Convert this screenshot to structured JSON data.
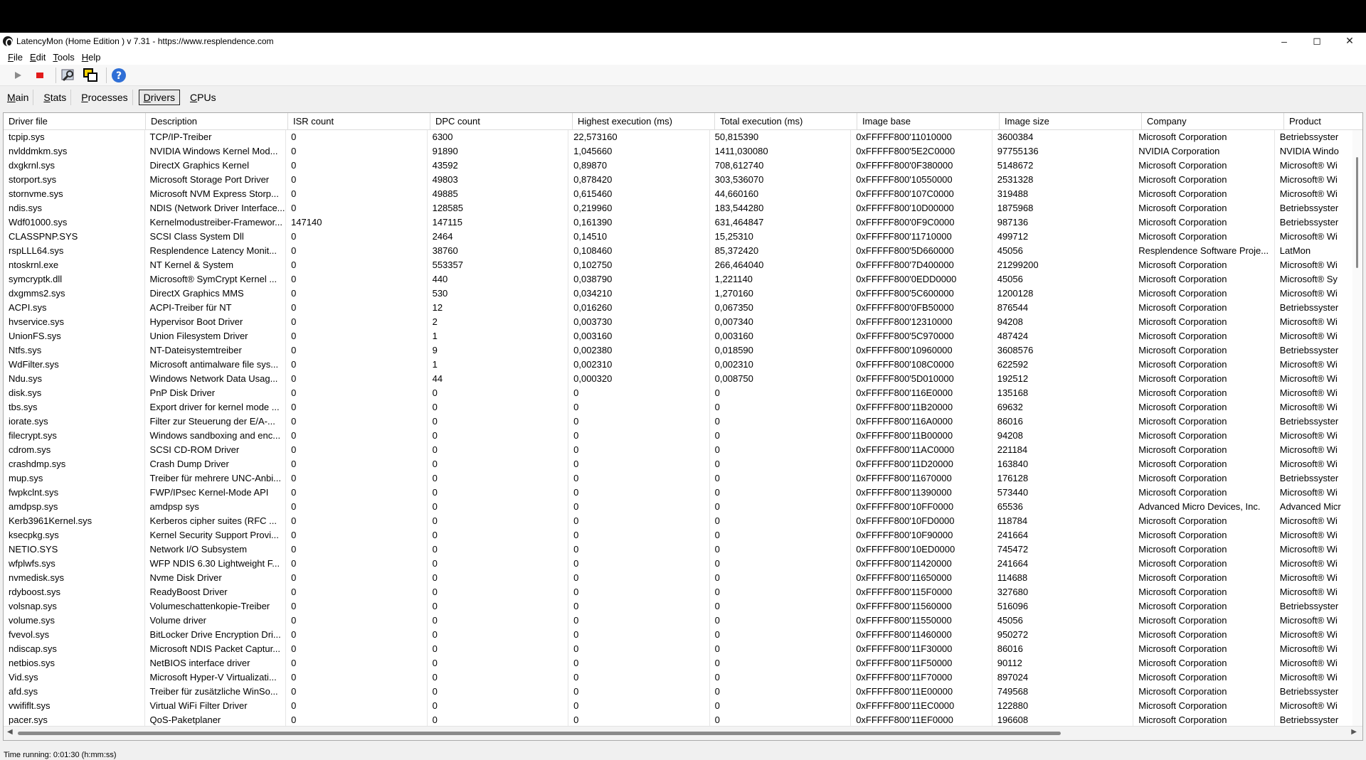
{
  "window": {
    "title": "LatencyMon  (Home Edition )  v 7.31 - https://www.resplendence.com",
    "controls": {
      "minimize": "–",
      "maximize": "◻",
      "close": "✕"
    }
  },
  "menu": [
    {
      "first": "F",
      "rest": "ile"
    },
    {
      "first": "E",
      "rest": "dit"
    },
    {
      "first": "T",
      "rest": "ools"
    },
    {
      "first": "H",
      "rest": "elp"
    }
  ],
  "toolbar": {
    "icons": [
      "play-icon",
      "stop-icon",
      "search-settings-icon",
      "windows-icon",
      "help-icon"
    ],
    "colors": {
      "play": "#8a8a8a",
      "stop": "#e21b1b",
      "help": "#2f6fd6"
    }
  },
  "tabs": [
    {
      "first": "M",
      "rest": "ain",
      "active": false
    },
    {
      "first": "S",
      "rest": "tats",
      "active": false
    },
    {
      "first": "P",
      "rest": "rocesses",
      "active": false
    },
    {
      "first": "D",
      "rest": "rivers",
      "active": true
    },
    {
      "first": "C",
      "rest": "PUs",
      "active": false
    }
  ],
  "table": {
    "columns": [
      "Driver file",
      "Description",
      "ISR count",
      "DPC count",
      "Highest execution (ms)",
      "Total execution (ms)",
      "Image base",
      "Image size",
      "Company",
      "Product"
    ],
    "rows": [
      [
        "tcpip.sys",
        "TCP/IP-Treiber",
        "0",
        "6300",
        "22,573160",
        "50,815390",
        "0xFFFFF800'11010000",
        "3600384",
        "Microsoft Corporation",
        "Betriebssyster"
      ],
      [
        "nvlddmkm.sys",
        "NVIDIA Windows Kernel Mod...",
        "0",
        "91890",
        "1,045660",
        "1411,030080",
        "0xFFFFF800'5E2C0000",
        "97755136",
        "NVIDIA Corporation",
        "NVIDIA Windo"
      ],
      [
        "dxgkrnl.sys",
        "DirectX Graphics Kernel",
        "0",
        "43592",
        "0,89870",
        "708,612740",
        "0xFFFFF800'0F380000",
        "5148672",
        "Microsoft Corporation",
        "Microsoft® Wi"
      ],
      [
        "storport.sys",
        "Microsoft Storage Port Driver",
        "0",
        "49803",
        "0,878420",
        "303,536070",
        "0xFFFFF800'10550000",
        "2531328",
        "Microsoft Corporation",
        "Microsoft® Wi"
      ],
      [
        "stornvme.sys",
        "Microsoft NVM Express Storp...",
        "0",
        "49885",
        "0,615460",
        "44,660160",
        "0xFFFFF800'107C0000",
        "319488",
        "Microsoft Corporation",
        "Microsoft® Wi"
      ],
      [
        "ndis.sys",
        "NDIS (Network Driver Interface...",
        "0",
        "128585",
        "0,219960",
        "183,544280",
        "0xFFFFF800'10D00000",
        "1875968",
        "Microsoft Corporation",
        "Betriebssyster"
      ],
      [
        "Wdf01000.sys",
        "Kernelmodustreiber-Framewor...",
        "147140",
        "147115",
        "0,161390",
        "631,464847",
        "0xFFFFF800'0F9C0000",
        "987136",
        "Microsoft Corporation",
        "Betriebssyster"
      ],
      [
        "CLASSPNP.SYS",
        "SCSI Class System Dll",
        "0",
        "2464",
        "0,14510",
        "15,25310",
        "0xFFFFF800'11710000",
        "499712",
        "Microsoft Corporation",
        "Microsoft® Wi"
      ],
      [
        "rspLLL64.sys",
        "Resplendence Latency Monit...",
        "0",
        "38760",
        "0,108460",
        "85,372420",
        "0xFFFFF800'5D660000",
        "45056",
        "Resplendence Software Proje...",
        "LatMon"
      ],
      [
        "ntoskrnl.exe",
        "NT Kernel & System",
        "0",
        "553357",
        "0,102750",
        "266,464040",
        "0xFFFFF800'7D400000",
        "21299200",
        "Microsoft Corporation",
        "Microsoft® Wi"
      ],
      [
        "symcryptk.dll",
        "Microsoft® SymCrypt Kernel ...",
        "0",
        "440",
        "0,038790",
        "1,221140",
        "0xFFFFF800'0EDD0000",
        "45056",
        "Microsoft Corporation",
        "Microsoft® Sy"
      ],
      [
        "dxgmms2.sys",
        "DirectX Graphics MMS",
        "0",
        "530",
        "0,034210",
        "1,270160",
        "0xFFFFF800'5C600000",
        "1200128",
        "Microsoft Corporation",
        "Microsoft® Wi"
      ],
      [
        "ACPI.sys",
        "ACPI-Treiber für NT",
        "0",
        "12",
        "0,016260",
        "0,067350",
        "0xFFFFF800'0FB50000",
        "876544",
        "Microsoft Corporation",
        "Betriebssyster"
      ],
      [
        "hvservice.sys",
        "Hypervisor Boot Driver",
        "0",
        "2",
        "0,003730",
        "0,007340",
        "0xFFFFF800'12310000",
        "94208",
        "Microsoft Corporation",
        "Microsoft® Wi"
      ],
      [
        "UnionFS.sys",
        "Union Filesystem Driver",
        "0",
        "1",
        "0,003160",
        "0,003160",
        "0xFFFFF800'5C970000",
        "487424",
        "Microsoft Corporation",
        "Microsoft® Wi"
      ],
      [
        "Ntfs.sys",
        "NT-Dateisystemtreiber",
        "0",
        "9",
        "0,002380",
        "0,018590",
        "0xFFFFF800'10960000",
        "3608576",
        "Microsoft Corporation",
        "Betriebssyster"
      ],
      [
        "WdFilter.sys",
        "Microsoft antimalware file sys...",
        "0",
        "1",
        "0,002310",
        "0,002310",
        "0xFFFFF800'108C0000",
        "622592",
        "Microsoft Corporation",
        "Microsoft® Wi"
      ],
      [
        "Ndu.sys",
        "Windows Network Data Usag...",
        "0",
        "44",
        "0,000320",
        "0,008750",
        "0xFFFFF800'5D010000",
        "192512",
        "Microsoft Corporation",
        "Microsoft® Wi"
      ],
      [
        "disk.sys",
        "PnP Disk Driver",
        "0",
        "0",
        "0",
        "0",
        "0xFFFFF800'116E0000",
        "135168",
        "Microsoft Corporation",
        "Microsoft® Wi"
      ],
      [
        "tbs.sys",
        "Export driver for kernel mode ...",
        "0",
        "0",
        "0",
        "0",
        "0xFFFFF800'11B20000",
        "69632",
        "Microsoft Corporation",
        "Microsoft® Wi"
      ],
      [
        "iorate.sys",
        "Filter zur Steuerung der E/A-...",
        "0",
        "0",
        "0",
        "0",
        "0xFFFFF800'116A0000",
        "86016",
        "Microsoft Corporation",
        "Betriebssyster"
      ],
      [
        "filecrypt.sys",
        "Windows sandboxing and enc...",
        "0",
        "0",
        "0",
        "0",
        "0xFFFFF800'11B00000",
        "94208",
        "Microsoft Corporation",
        "Microsoft® Wi"
      ],
      [
        "cdrom.sys",
        "SCSI CD-ROM Driver",
        "0",
        "0",
        "0",
        "0",
        "0xFFFFF800'11AC0000",
        "221184",
        "Microsoft Corporation",
        "Microsoft® Wi"
      ],
      [
        "crashdmp.sys",
        "Crash Dump Driver",
        "0",
        "0",
        "0",
        "0",
        "0xFFFFF800'11D20000",
        "163840",
        "Microsoft Corporation",
        "Microsoft® Wi"
      ],
      [
        "mup.sys",
        "Treiber für mehrere UNC-Anbi...",
        "0",
        "0",
        "0",
        "0",
        "0xFFFFF800'11670000",
        "176128",
        "Microsoft Corporation",
        "Betriebssyster"
      ],
      [
        "fwpkclnt.sys",
        "FWP/IPsec Kernel-Mode API",
        "0",
        "0",
        "0",
        "0",
        "0xFFFFF800'11390000",
        "573440",
        "Microsoft Corporation",
        "Microsoft® Wi"
      ],
      [
        "amdpsp.sys",
        "amdpsp sys",
        "0",
        "0",
        "0",
        "0",
        "0xFFFFF800'10FF0000",
        "65536",
        "Advanced Micro Devices, Inc.",
        "Advanced Micr"
      ],
      [
        "Kerb3961Kernel.sys",
        "Kerberos cipher suites (RFC ...",
        "0",
        "0",
        "0",
        "0",
        "0xFFFFF800'10FD0000",
        "118784",
        "Microsoft Corporation",
        "Microsoft® Wi"
      ],
      [
        "ksecpkg.sys",
        "Kernel Security Support Provi...",
        "0",
        "0",
        "0",
        "0",
        "0xFFFFF800'10F90000",
        "241664",
        "Microsoft Corporation",
        "Microsoft® Wi"
      ],
      [
        "NETIO.SYS",
        "Network I/O Subsystem",
        "0",
        "0",
        "0",
        "0",
        "0xFFFFF800'10ED0000",
        "745472",
        "Microsoft Corporation",
        "Microsoft® Wi"
      ],
      [
        "wfplwfs.sys",
        "WFP NDIS 6.30 Lightweight F...",
        "0",
        "0",
        "0",
        "0",
        "0xFFFFF800'11420000",
        "241664",
        "Microsoft Corporation",
        "Microsoft® Wi"
      ],
      [
        "nvmedisk.sys",
        "Nvme Disk Driver",
        "0",
        "0",
        "0",
        "0",
        "0xFFFFF800'11650000",
        "114688",
        "Microsoft Corporation",
        "Microsoft® Wi"
      ],
      [
        "rdyboost.sys",
        "ReadyBoost Driver",
        "0",
        "0",
        "0",
        "0",
        "0xFFFFF800'115F0000",
        "327680",
        "Microsoft Corporation",
        "Microsoft® Wi"
      ],
      [
        "volsnap.sys",
        "Volumeschattenkopie-Treiber",
        "0",
        "0",
        "0",
        "0",
        "0xFFFFF800'11560000",
        "516096",
        "Microsoft Corporation",
        "Betriebssyster"
      ],
      [
        "volume.sys",
        "Volume driver",
        "0",
        "0",
        "0",
        "0",
        "0xFFFFF800'11550000",
        "45056",
        "Microsoft Corporation",
        "Microsoft® Wi"
      ],
      [
        "fvevol.sys",
        "BitLocker Drive Encryption Dri...",
        "0",
        "0",
        "0",
        "0",
        "0xFFFFF800'11460000",
        "950272",
        "Microsoft Corporation",
        "Microsoft® Wi"
      ],
      [
        "ndiscap.sys",
        "Microsoft NDIS Packet Captur...",
        "0",
        "0",
        "0",
        "0",
        "0xFFFFF800'11F30000",
        "86016",
        "Microsoft Corporation",
        "Microsoft® Wi"
      ],
      [
        "netbios.sys",
        "NetBIOS interface driver",
        "0",
        "0",
        "0",
        "0",
        "0xFFFFF800'11F50000",
        "90112",
        "Microsoft Corporation",
        "Microsoft® Wi"
      ],
      [
        "Vid.sys",
        "Microsoft Hyper-V Virtualizati...",
        "0",
        "0",
        "0",
        "0",
        "0xFFFFF800'11F70000",
        "897024",
        "Microsoft Corporation",
        "Microsoft® Wi"
      ],
      [
        "afd.sys",
        "Treiber für zusätzliche WinSo...",
        "0",
        "0",
        "0",
        "0",
        "0xFFFFF800'11E00000",
        "749568",
        "Microsoft Corporation",
        "Betriebssyster"
      ],
      [
        "vwififlt.sys",
        "Virtual WiFi Filter Driver",
        "0",
        "0",
        "0",
        "0",
        "0xFFFFF800'11EC0000",
        "122880",
        "Microsoft Corporation",
        "Microsoft® Wi"
      ],
      [
        "pacer.sys",
        "QoS-Paketplaner",
        "0",
        "0",
        "0",
        "0",
        "0xFFFFF800'11EF0000",
        "196608",
        "Microsoft Corporation",
        "Betriebssyster"
      ]
    ]
  },
  "status": {
    "text": "Time running: 0:01:30  (h:mm:ss)"
  }
}
